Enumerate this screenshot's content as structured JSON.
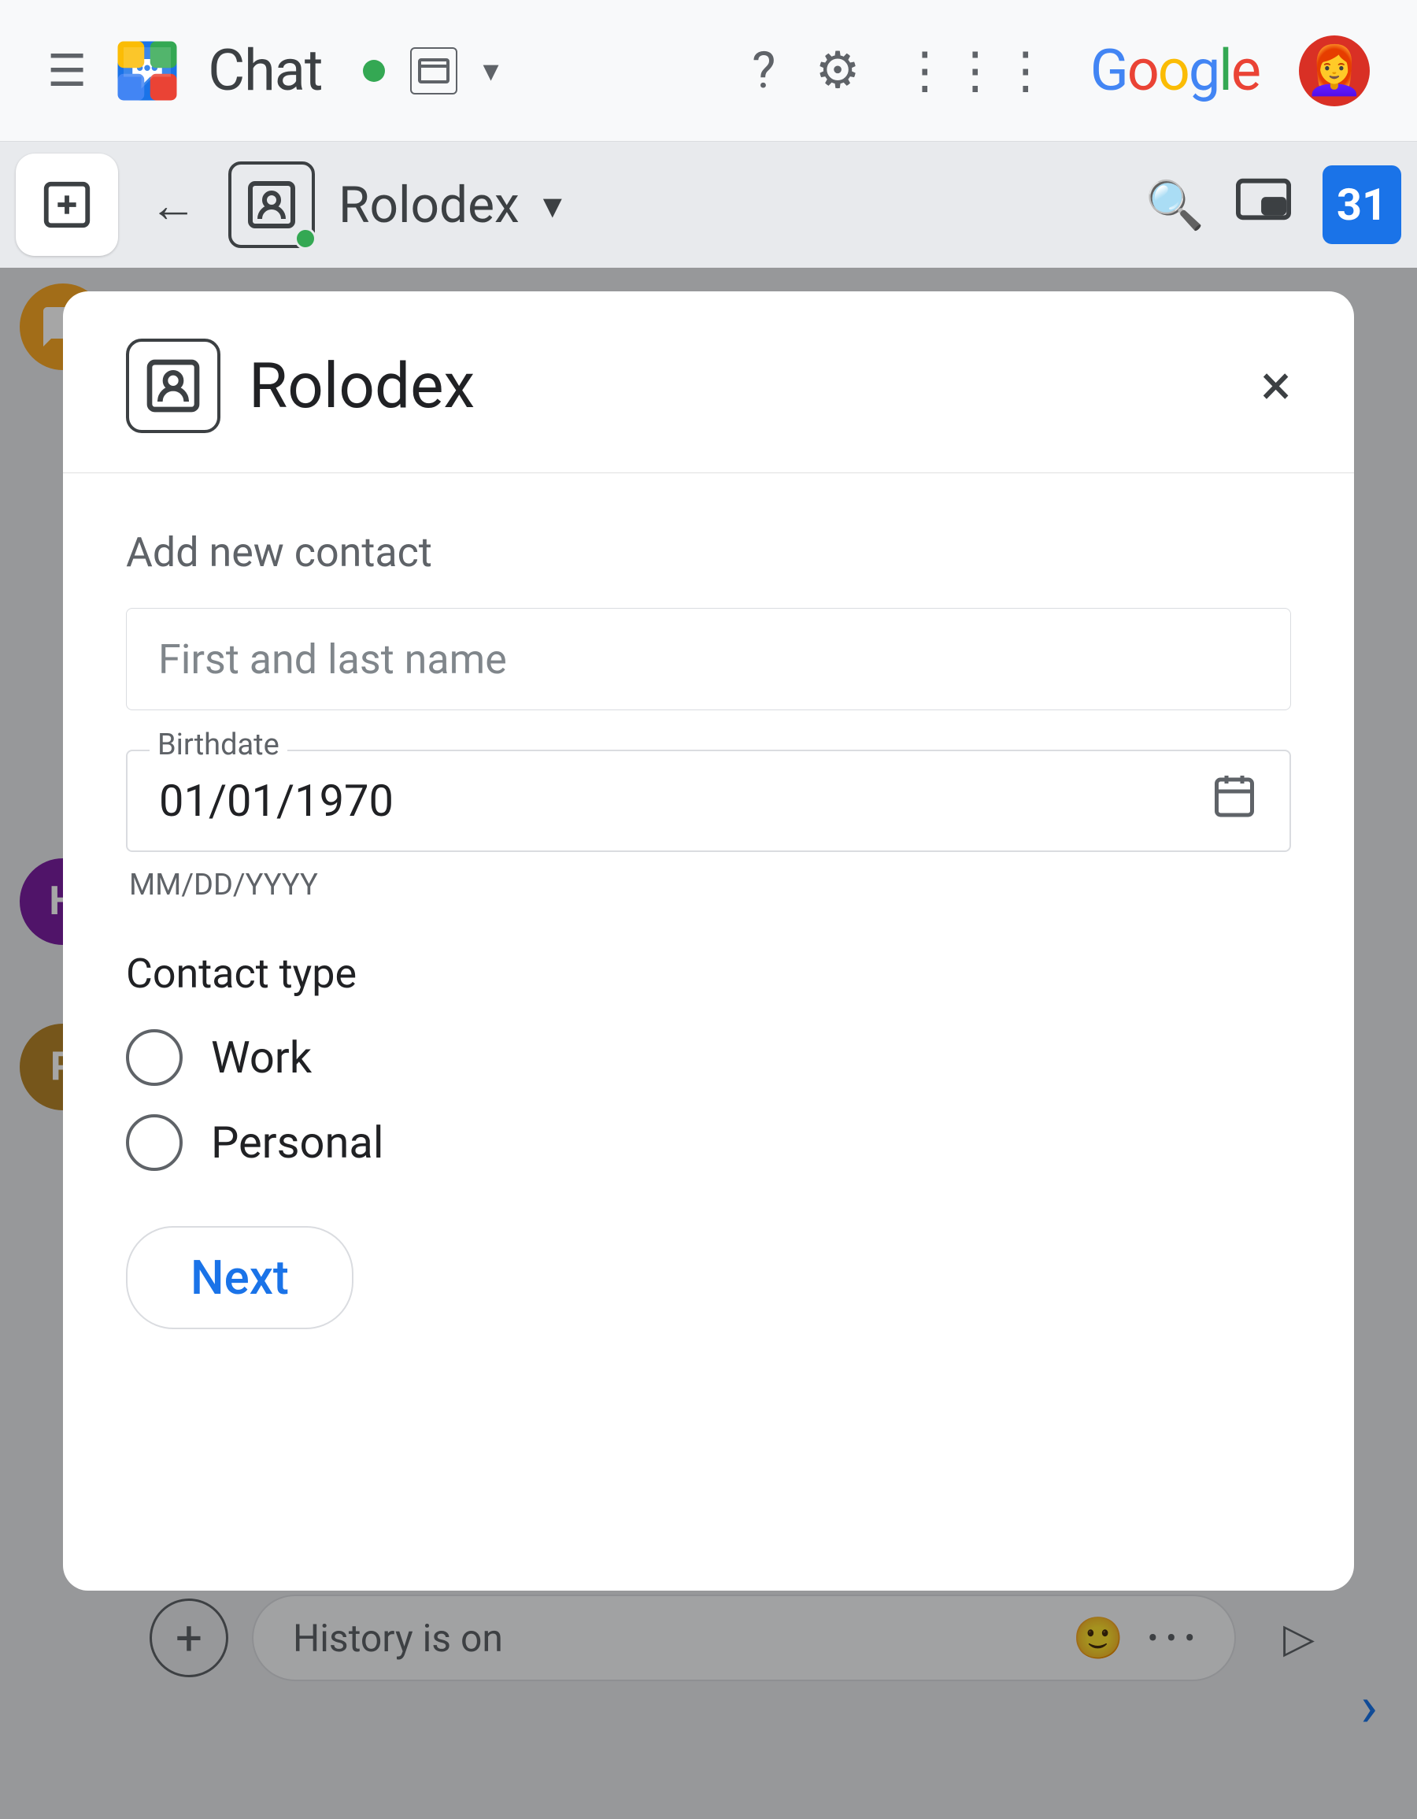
{
  "topbar": {
    "chat_label": "Chat",
    "google_label": "Google"
  },
  "subbar": {
    "rolodex_label": "Rolodex"
  },
  "modal": {
    "title": "Rolodex",
    "close_label": "×",
    "section_label": "Add new contact",
    "name_placeholder": "First and last name",
    "birthdate_field_label": "Birthdate",
    "birthdate_value": "01/01/1970",
    "birthdate_hint": "MM/DD/YYYY",
    "contact_type_label": "Contact type",
    "contact_types": [
      {
        "id": "work",
        "label": "Work"
      },
      {
        "id": "personal",
        "label": "Personal"
      }
    ],
    "next_btn_label": "Next"
  },
  "chatbar": {
    "history_text": "History is on",
    "add_icon": "+",
    "emoji_icon": "🙂",
    "more_icon": "•••",
    "send_icon": "▷"
  },
  "sidebar": {
    "avatars": [
      {
        "letter": "",
        "color": "#f9a825",
        "name": "yellow-avatar"
      },
      {
        "letter": "H",
        "color": "#7b1fa2",
        "name": "purple-avatar"
      },
      {
        "letter": "P",
        "color": "#b5842a",
        "name": "brown-avatar"
      }
    ]
  },
  "calendar_badge": "31"
}
